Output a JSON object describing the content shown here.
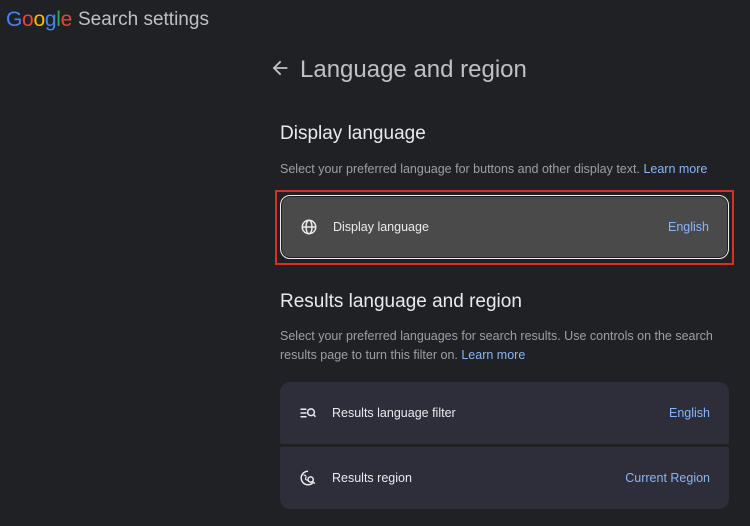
{
  "header": {
    "logo_letters": [
      {
        "char": "G",
        "color": "#4285F4"
      },
      {
        "char": "o",
        "color": "#EA4335"
      },
      {
        "char": "o",
        "color": "#FBBC05"
      },
      {
        "char": "g",
        "color": "#4285F4"
      },
      {
        "char": "l",
        "color": "#34A853"
      },
      {
        "char": "e",
        "color": "#EA4335"
      }
    ],
    "title": "Search settings"
  },
  "page": {
    "back_icon": "arrow-back-icon",
    "title": "Language and region"
  },
  "display_language": {
    "heading": "Display language",
    "description": "Select your preferred language for buttons and other display text.",
    "learn_more": "Learn more",
    "row": {
      "icon": "globe-icon",
      "label": "Display language",
      "value": "English",
      "selected": true
    }
  },
  "results": {
    "heading": "Results language and region",
    "description": "Select your preferred languages for search results. Use controls on the search results page to turn this filter on.",
    "learn_more": "Learn more",
    "rows": [
      {
        "icon": "language-filter-icon",
        "label": "Results language filter",
        "value": "English"
      },
      {
        "icon": "region-search-icon",
        "label": "Results region",
        "value": "Current Region"
      }
    ]
  },
  "colors": {
    "background": "#202124",
    "link": "#8ab4f8",
    "highlight": "#d93025",
    "card": "#2d2e3a"
  }
}
